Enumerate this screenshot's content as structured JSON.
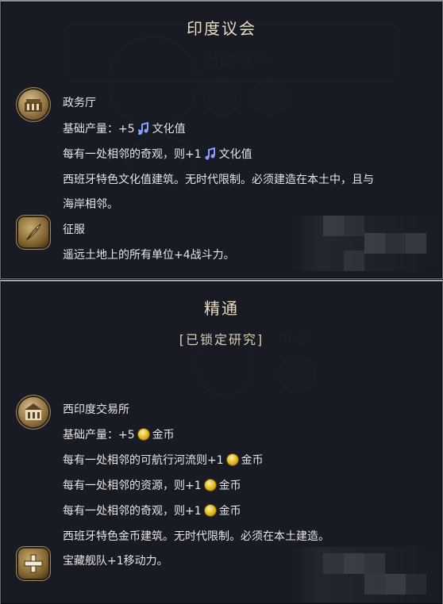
{
  "background_ghost": {
    "top_label": "无敌舰队",
    "bottom_label": "精通"
  },
  "top_panel": {
    "title": "印度议会",
    "items": [
      {
        "icon": "palace-icon",
        "name": "政务厅",
        "lines": [
          {
            "prefix": "基础产量：+5",
            "icon": "culture-icon",
            "suffix": "文化值"
          },
          {
            "prefix": "每有一处相邻的奇观，则+1",
            "icon": "culture-icon",
            "suffix": "文化值"
          },
          {
            "text": "西班牙特色文化值建筑。无时代限制。必须建造在本土中，且与"
          },
          {
            "text": "海岸相邻。"
          }
        ]
      },
      {
        "icon": "quill-icon",
        "name": "征服",
        "lines": [
          {
            "text": "遥远土地上的所有单位+4战斗力。"
          }
        ]
      }
    ]
  },
  "bottom_panel": {
    "title": "精通",
    "subtitle": "[已锁定研究]",
    "items": [
      {
        "icon": "trading-house-icon",
        "name": "西印度交易所",
        "lines": [
          {
            "prefix": "基础产量：+5",
            "icon": "gold-icon",
            "suffix": "金币"
          },
          {
            "prefix": "每有一处相邻的可航行河流则+1",
            "icon": "gold-icon",
            "suffix": "金币"
          },
          {
            "prefix": "每有一处相邻的资源，则+1",
            "icon": "gold-icon",
            "suffix": "金币"
          },
          {
            "prefix": "每有一处相邻的奇观，则+1",
            "icon": "gold-icon",
            "suffix": "金币"
          },
          {
            "text": "西班牙特色金币建筑。无时代限制。必须在本土建造。"
          }
        ]
      },
      {
        "icon": "plus-icon",
        "name": "宝藏舰队+1移动力。",
        "lines": []
      }
    ]
  },
  "colors": {
    "title": "#e9dcc0",
    "text": "#e6e6e6",
    "gold": "#e0b51a",
    "culture": "#8b9cff"
  }
}
